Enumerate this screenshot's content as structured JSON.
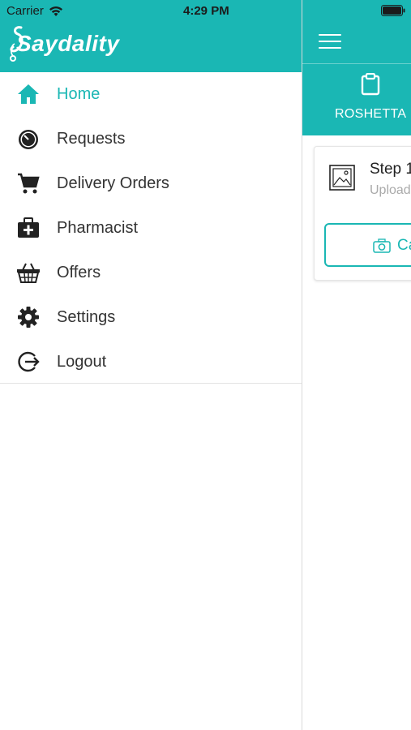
{
  "status_bar": {
    "carrier": "Carrier",
    "time": "4:29 PM"
  },
  "drawer": {
    "logo_text": "Saydality",
    "menu": [
      {
        "label": "Home",
        "icon": "home-icon",
        "active": true
      },
      {
        "label": "Requests",
        "icon": "stopwatch-icon",
        "active": false
      },
      {
        "label": "Delivery Orders",
        "icon": "cart-icon",
        "active": false
      },
      {
        "label": "Pharmacist",
        "icon": "medical-kit-icon",
        "active": false
      },
      {
        "label": "Offers",
        "icon": "basket-icon",
        "active": false
      },
      {
        "label": "Settings",
        "icon": "gear-icon",
        "active": false
      },
      {
        "label": "Logout",
        "icon": "logout-icon",
        "active": false
      }
    ]
  },
  "main": {
    "tab_label": "ROSHETTA",
    "card": {
      "title": "Step 1",
      "subtitle": "Upload",
      "camera_label": "Camera"
    }
  },
  "colors": {
    "accent": "#1ab7b4",
    "text": "#333333",
    "muted": "#aaaaaa"
  }
}
